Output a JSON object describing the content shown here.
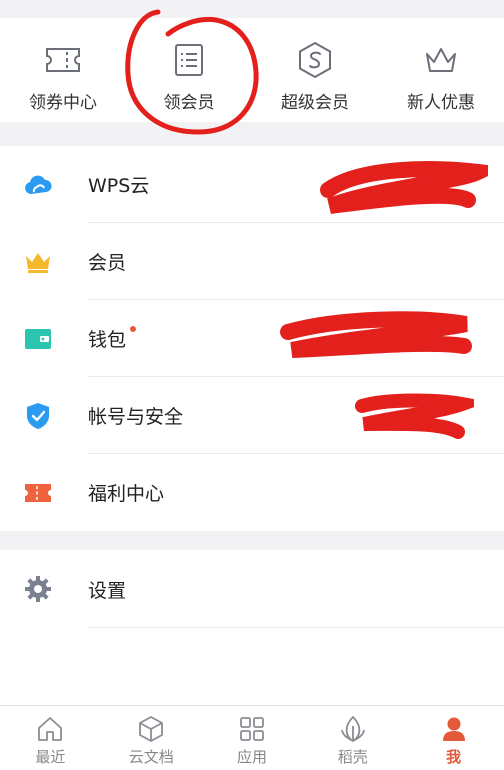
{
  "quick_actions": [
    {
      "label": "领券中心",
      "icon": "ticket-icon"
    },
    {
      "label": "领会员",
      "icon": "list-card-icon"
    },
    {
      "label": "超级会员",
      "icon": "s-hexagon-icon"
    },
    {
      "label": "新人优惠",
      "icon": "crown-outline-icon"
    }
  ],
  "menu": [
    {
      "label": "WPS云",
      "icon": "cloud-icon",
      "color": "#2a9bf0"
    },
    {
      "label": "会员",
      "icon": "crown-icon",
      "color": "#f5b82a"
    },
    {
      "label": "钱包",
      "icon": "wallet-icon",
      "color": "#2cc5b0",
      "badge": true
    },
    {
      "label": "帐号与安全",
      "icon": "shield-check-icon",
      "color": "#2a9bf0"
    },
    {
      "label": "福利中心",
      "icon": "welfare-ticket-icon",
      "color": "#f0623c"
    }
  ],
  "settings": {
    "label": "设置",
    "icon": "gear-icon",
    "color": "#7a8190"
  },
  "tabs": [
    {
      "label": "最近",
      "icon": "home-icon"
    },
    {
      "label": "云文档",
      "icon": "cube-icon"
    },
    {
      "label": "应用",
      "icon": "grid-apps-icon"
    },
    {
      "label": "稻壳",
      "icon": "leaf-icon"
    },
    {
      "label": "我",
      "icon": "person-icon",
      "active": true
    }
  ],
  "colors": {
    "accent": "#e25a3a",
    "annotation_red": "#e3201b",
    "badge": "#e8583f"
  }
}
